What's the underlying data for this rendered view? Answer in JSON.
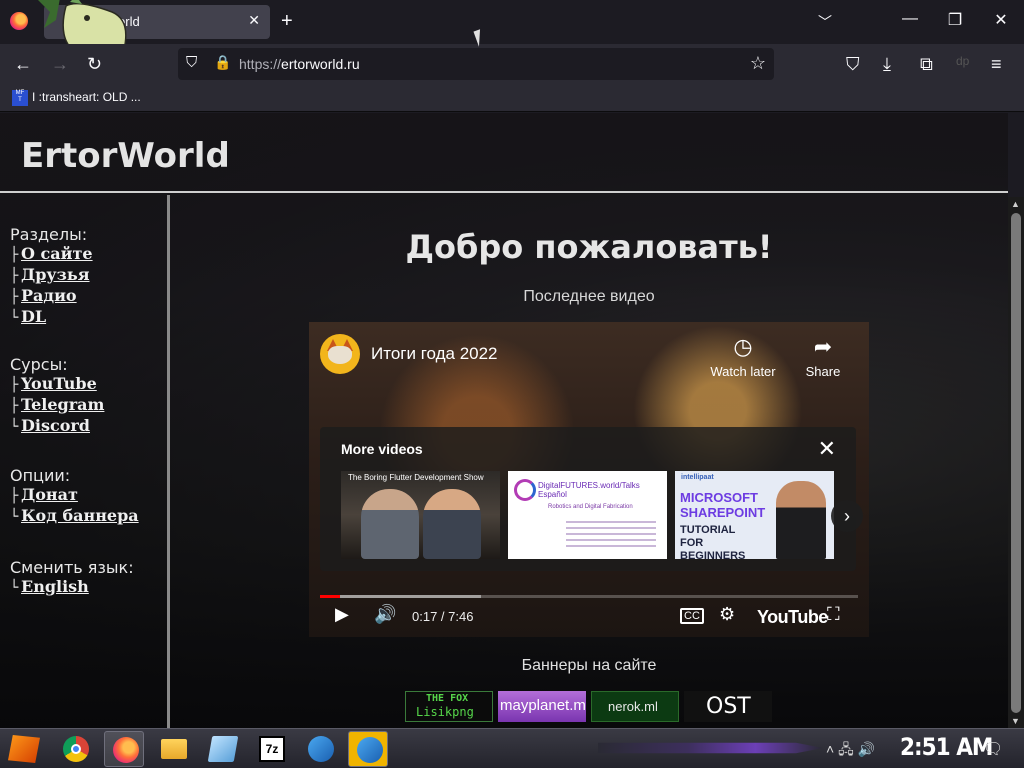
{
  "browser": {
    "tab_title": "World",
    "url_protocol": "https://",
    "url_host": "ertorworld.ru",
    "bookmark_label": "I :transheart: OLD ...",
    "bookmark_favicon": "MF\nT"
  },
  "site": {
    "title": "ErtorWorld",
    "sections_head": "Разделы:",
    "sections": [
      "О сайте",
      "Друзья",
      "Радио",
      "DL"
    ],
    "sources_head": "Сурсы:",
    "sources": [
      "YouTube",
      "Telegram",
      "Discord"
    ],
    "options_head": "Опции:",
    "options": [
      "Донат",
      "Код баннера"
    ],
    "language_head": "Сменить язык:",
    "language_link": "English",
    "welcome": "Добро пожаловать!",
    "latest_video_label": "Последнее видео",
    "banners_label": "Баннеры на сайте",
    "banners": [
      {
        "line1": "THE FOX",
        "line2": "Lisikpng"
      },
      {
        "text": "mayplanet.ml"
      },
      {
        "text": "nerok.ml"
      },
      {
        "text": "OST"
      }
    ]
  },
  "video": {
    "title": "Итоги года 2022",
    "watch_later": "Watch later",
    "share": "Share",
    "more_videos": "More videos",
    "thumb1_caption": "The Boring Flutter Development Show",
    "thumb2_caption": "DigitalFUTURES.world/Talks Español",
    "thumb2_sub": "Robotics and Digital Fabrication",
    "thumb3_brand": "intellipaat",
    "thumb3_title": "MICROSOFT SHAREPOINT",
    "thumb3_sub": "TUTORIAL FOR BEGINNERS",
    "time": "0:17 / 7:46",
    "progress": 0.037,
    "buffered": 0.3,
    "yt_logo": "YouTube",
    "cc": "CC"
  },
  "taskbar": {
    "clock": "2:51 AM"
  },
  "colors": {
    "browser_bg": "#1c1b22",
    "toolbar": "#2b2a33",
    "accent_red": "#ff0000",
    "start_orange": "#ff9b1a"
  },
  "icons": [
    "firefox-icon",
    "close-icon",
    "plus-icon",
    "chevron-down-icon",
    "back-icon",
    "forward-icon",
    "reload-icon",
    "shield-icon",
    "lock-icon",
    "star-icon",
    "pocket-icon",
    "download-icon",
    "extensions-icon",
    "menu-icon",
    "clock-icon",
    "share-icon",
    "play-icon",
    "volume-icon",
    "settings-icon",
    "fullscreen-icon"
  ]
}
